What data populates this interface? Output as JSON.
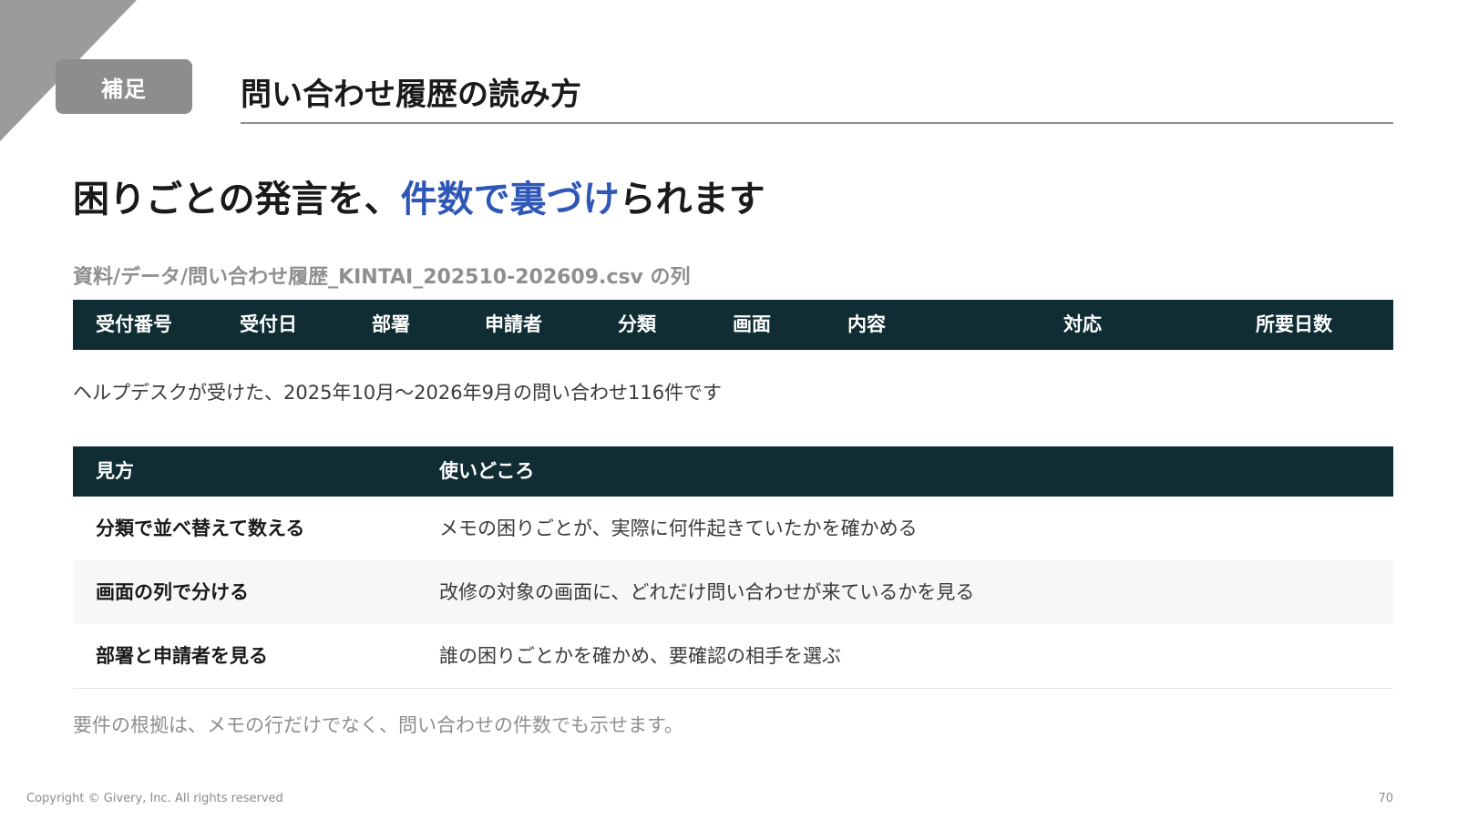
{
  "badge": "補足",
  "page_title": "問い合わせ履歴の読み方",
  "headline": {
    "before": "困りごとの発言を、",
    "accent": "件数で裏づけ",
    "after": "られます"
  },
  "source_label": "資料/データ/問い合わせ履歴_KINTAI_202510-202609.csv の列",
  "csv_columns": [
    "受付番号",
    "受付日",
    "部署",
    "申請者",
    "分類",
    "画面",
    "内容",
    "対応",
    "所要日数"
  ],
  "description": "ヘルプデスクが受けた、2025年10月〜2026年9月の問い合わせ116件です",
  "table": {
    "headers": [
      "見方",
      "使いどころ"
    ],
    "rows": [
      [
        "分類で並べ替えて数える",
        "メモの困りごとが、実際に何件起きていたかを確かめる"
      ],
      [
        "画面の列で分ける",
        "改修の対象の画面に、どれだけ問い合わせが来ているかを見る"
      ],
      [
        "部署と申請者を見る",
        "誰の困りごとかを確かめ、要確認の相手を選ぶ"
      ]
    ]
  },
  "note": "要件の根拠は、メモの行だけでなく、問い合わせの件数でも示せます。",
  "footer": {
    "copyright": "Copyright © Givery, Inc. All rights reserved",
    "page_number": "70"
  },
  "colors": {
    "accent": "#2f57b7",
    "header_bg": "#0f2d33",
    "badge_bg": "#8d8d8d"
  }
}
